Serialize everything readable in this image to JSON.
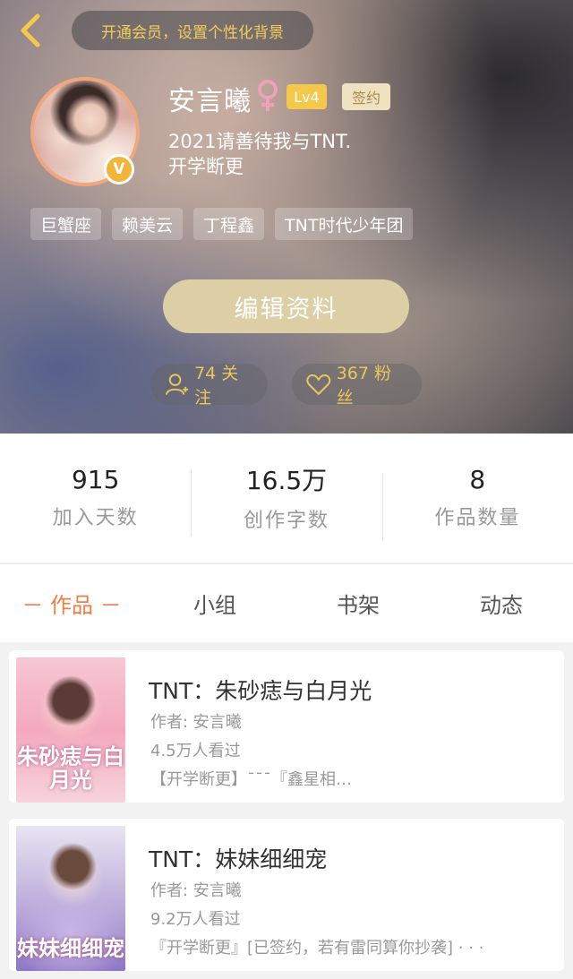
{
  "header": {
    "vip_prompt": "开通会员，设置个性化背景",
    "username": "安言曦",
    "level": "Lv4",
    "signed_badge": "签约",
    "verified_badge": "V",
    "bio_line1": "2021请善待我与TNT.",
    "bio_line2": "开学断更",
    "tags": [
      "巨蟹座",
      "赖美云",
      "丁程鑫",
      "TNT时代少年团"
    ],
    "edit_button": "编辑资料",
    "following_label": "74 关注",
    "fans_label": "367 粉丝"
  },
  "stats": [
    {
      "value": "915",
      "label": "加入天数"
    },
    {
      "value": "16.5万",
      "label": "创作字数"
    },
    {
      "value": "8",
      "label": "作品数量"
    }
  ],
  "tabs": [
    "－ 作品 －",
    "小组",
    "书架",
    "动态"
  ],
  "books": [
    {
      "title": "TNT：朱砂痣与白月光",
      "author": "作者: 安言曦",
      "views": "4.5万人看过",
      "desc": "【开学断更】¯¯¯『鑫星相…",
      "cover_text": "朱砂痣与白月光"
    },
    {
      "title": "TNT：妹妹细细宠",
      "author": "作者: 安言曦",
      "views": "9.2万人看过",
      "desc": "『开学断更』[已签约，若有雷同算你抄袭] · · ·",
      "cover_text": "妹妹细细宠"
    }
  ],
  "colors": {
    "accent_orange": "#ef7e4a",
    "gold": "#e9c75a",
    "edit_button_bg": "#dccfa6"
  },
  "icons": {
    "back": "chevron-left-icon",
    "gender": "female-icon",
    "following": "user-plus-icon",
    "fans": "heart-icon"
  }
}
